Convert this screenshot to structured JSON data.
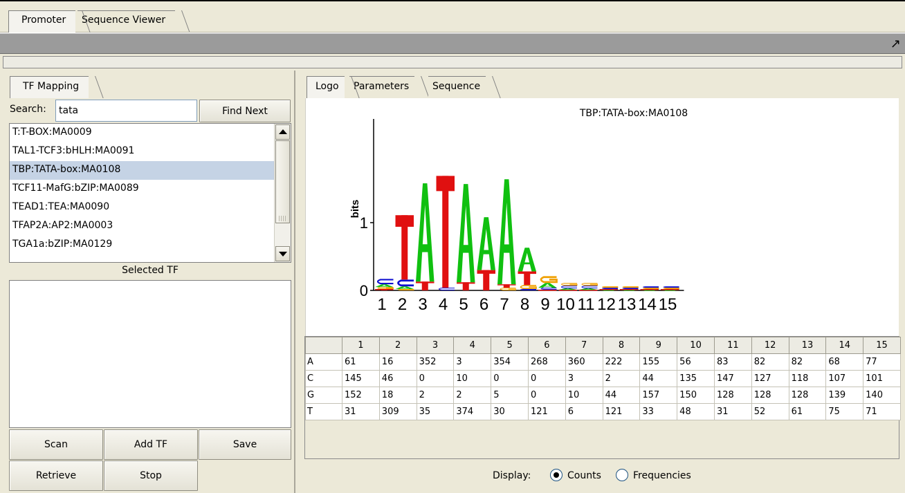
{
  "window": {
    "tabs": [
      {
        "label": "Promoter",
        "active": true
      },
      {
        "label": "Sequence Viewer",
        "active": false
      }
    ]
  },
  "left_panel": {
    "tab": "TF Mapping",
    "search": {
      "label": "Search:",
      "value": "tata"
    },
    "find_next_label": "Find Next",
    "tf_list": [
      {
        "label": "T:T-BOX:MA0009",
        "selected": false
      },
      {
        "label": "TAL1-TCF3:bHLH:MA0091",
        "selected": false
      },
      {
        "label": "TBP:TATA-box:MA0108",
        "selected": true
      },
      {
        "label": "TCF11-MafG:bZIP:MA0089",
        "selected": false
      },
      {
        "label": "TEAD1:TEA:MA0090",
        "selected": false
      },
      {
        "label": "TFAP2A:AP2:MA0003",
        "selected": false
      },
      {
        "label": "TGA1a:bZIP:MA0129",
        "selected": false
      }
    ],
    "selected_tf_label": "Selected TF",
    "buttons": {
      "scan": "Scan",
      "add_tf": "Add TF",
      "save": "Save",
      "retrieve": "Retrieve",
      "stop": "Stop"
    }
  },
  "right_panel": {
    "tabs": [
      {
        "label": "Logo",
        "active": true
      },
      {
        "label": "Parameters",
        "active": false
      },
      {
        "label": "Sequence",
        "active": false
      }
    ],
    "logo": {
      "title": "TBP:TATA-box:MA0108",
      "ylabel": "bits",
      "y_ticks": [
        "0",
        "1"
      ],
      "x_ticks": [
        "1",
        "2",
        "3",
        "4",
        "5",
        "6",
        "7",
        "8",
        "9",
        "10",
        "11",
        "12",
        "13",
        "14",
        "15"
      ],
      "colors": {
        "A": "#10c010",
        "C": "#1010d0",
        "G": "#f0a000",
        "T": "#e01010"
      },
      "note_heights_in_bits": [
        {
          "G": 0.03,
          "C": 0.08,
          "A": 0.04,
          "T": 0.02
        },
        {
          "T": 0.95,
          "C": 0.1,
          "A": 0.04,
          "G": 0.02
        },
        {
          "A": 1.45,
          "T": 0.13,
          "C": 0.0,
          "G": 0.0
        },
        {
          "T": 1.65,
          "C": 0.04,
          "A": 0.0,
          "G": 0.0
        },
        {
          "A": 1.45,
          "T": 0.12,
          "C": 0.0,
          "G": 0.0
        },
        {
          "A": 0.78,
          "T": 0.3,
          "C": 0.0,
          "G": 0.0
        },
        {
          "A": 1.55,
          "T": 0.05,
          "G": 0.04,
          "C": 0.0
        },
        {
          "A": 0.35,
          "T": 0.2,
          "G": 0.06,
          "C": 0.02
        },
        {
          "G": 0.1,
          "A": 0.07,
          "C": 0.03,
          "T": 0.01
        },
        {
          "C": 0.04,
          "G": 0.04,
          "A": 0.02,
          "T": 0.01
        },
        {
          "C": 0.04,
          "G": 0.04,
          "A": 0.02,
          "T": 0.01
        },
        {
          "C": 0.02,
          "G": 0.02,
          "A": 0.01,
          "T": 0.01
        },
        {
          "C": 0.02,
          "G": 0.02,
          "A": 0.01,
          "T": 0.01
        },
        {
          "G": 0.02,
          "C": 0.02,
          "A": 0.01,
          "T": 0.01
        },
        {
          "G": 0.02,
          "C": 0.02,
          "A": 0.01,
          "T": 0.01
        }
      ]
    },
    "matrix": {
      "columns": [
        "1",
        "2",
        "3",
        "4",
        "5",
        "6",
        "7",
        "8",
        "9",
        "10",
        "11",
        "12",
        "13",
        "14",
        "15"
      ],
      "rows": [
        {
          "label": "A",
          "values": [
            "61",
            "16",
            "352",
            "3",
            "354",
            "268",
            "360",
            "222",
            "155",
            "56",
            "83",
            "82",
            "82",
            "68",
            "77"
          ]
        },
        {
          "label": "C",
          "values": [
            "145",
            "46",
            "0",
            "10",
            "0",
            "0",
            "3",
            "2",
            "44",
            "135",
            "147",
            "127",
            "118",
            "107",
            "101"
          ]
        },
        {
          "label": "G",
          "values": [
            "152",
            "18",
            "2",
            "2",
            "5",
            "0",
            "10",
            "44",
            "157",
            "150",
            "128",
            "128",
            "128",
            "139",
            "140"
          ]
        },
        {
          "label": "T",
          "values": [
            "31",
            "309",
            "35",
            "374",
            "30",
            "121",
            "6",
            "121",
            "33",
            "48",
            "31",
            "52",
            "61",
            "75",
            "71"
          ]
        }
      ]
    },
    "display": {
      "label": "Display:",
      "options": [
        {
          "label": "Counts",
          "checked": true
        },
        {
          "label": "Frequencies",
          "checked": false
        }
      ]
    }
  }
}
